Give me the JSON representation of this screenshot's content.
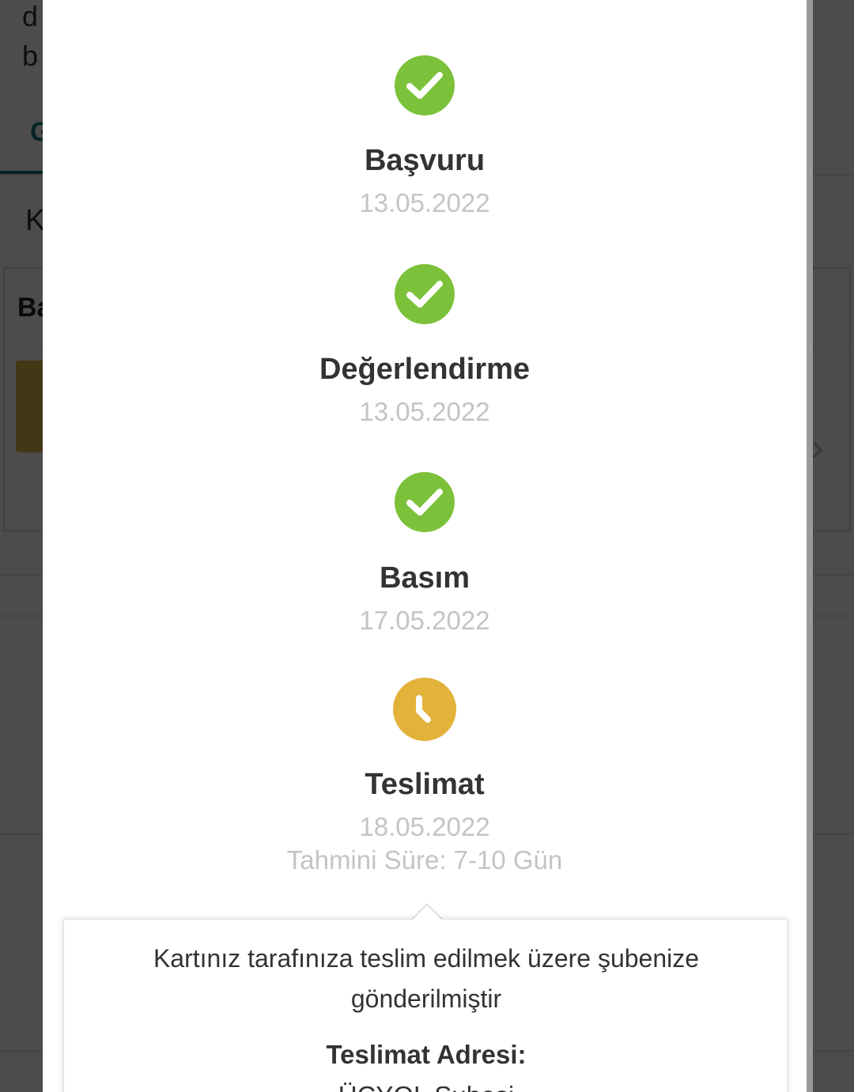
{
  "background": {
    "line1": "d",
    "line2": "b",
    "tab": "G",
    "k_text": "K",
    "card_title": "Ba"
  },
  "steps": [
    {
      "title": "Başvuru",
      "date": "13.05.2022",
      "status": "done",
      "icon": "check-icon"
    },
    {
      "title": "Değerlendirme",
      "date": "13.05.2022",
      "status": "done",
      "icon": "check-icon"
    },
    {
      "title": "Basım",
      "date": "17.05.2022",
      "status": "done",
      "icon": "check-icon"
    },
    {
      "title": "Teslimat",
      "date": "18.05.2022",
      "status": "pending",
      "icon": "clock-icon",
      "estimate": "Tahmini Süre: 7-10 Gün"
    }
  ],
  "info": {
    "message": "Kartınız tarafınıza teslim edilmek üzere şubenize gönderilmiştir",
    "address_label": "Teslimat Adresi:",
    "address_value": "ÜÇYOL Şubesi"
  },
  "colors": {
    "done": "#7cc13a",
    "pending": "#e2b23a",
    "accent": "#1a7a7a"
  }
}
